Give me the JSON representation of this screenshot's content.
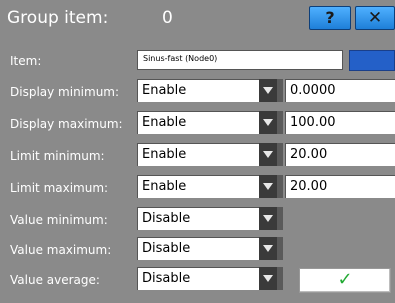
{
  "header": {
    "title": "Group item:",
    "group_value": "0",
    "help_label": "?",
    "close_label": "✕"
  },
  "item": {
    "label": "Item:",
    "value": "Sinus-fast (Node0)"
  },
  "rows": [
    {
      "label": "Display minimum:",
      "select": "Enable",
      "value": "0.0000"
    },
    {
      "label": "Display maximum:",
      "select": "Enable",
      "value": "100.00"
    },
    {
      "label": "Limit minimum:",
      "select": "Enable",
      "value": "20.00"
    },
    {
      "label": "Limit maximum:",
      "select": "Enable",
      "value": "20.00"
    },
    {
      "label": "Value minimum:",
      "select": "Disable"
    },
    {
      "label": "Value maximum:",
      "select": "Disable"
    },
    {
      "label": "Value average:",
      "select": "Disable"
    }
  ],
  "ok_label": "✓",
  "colors": {
    "background": "#8a8a8a",
    "title_button": "#2f93ec",
    "item_button": "#2460c8",
    "ok_check": "#22aa33"
  },
  "icons": {
    "help": "question-mark-icon",
    "close": "close-icon",
    "dropdown": "chevron-down-icon",
    "ok": "checkmark-icon"
  }
}
